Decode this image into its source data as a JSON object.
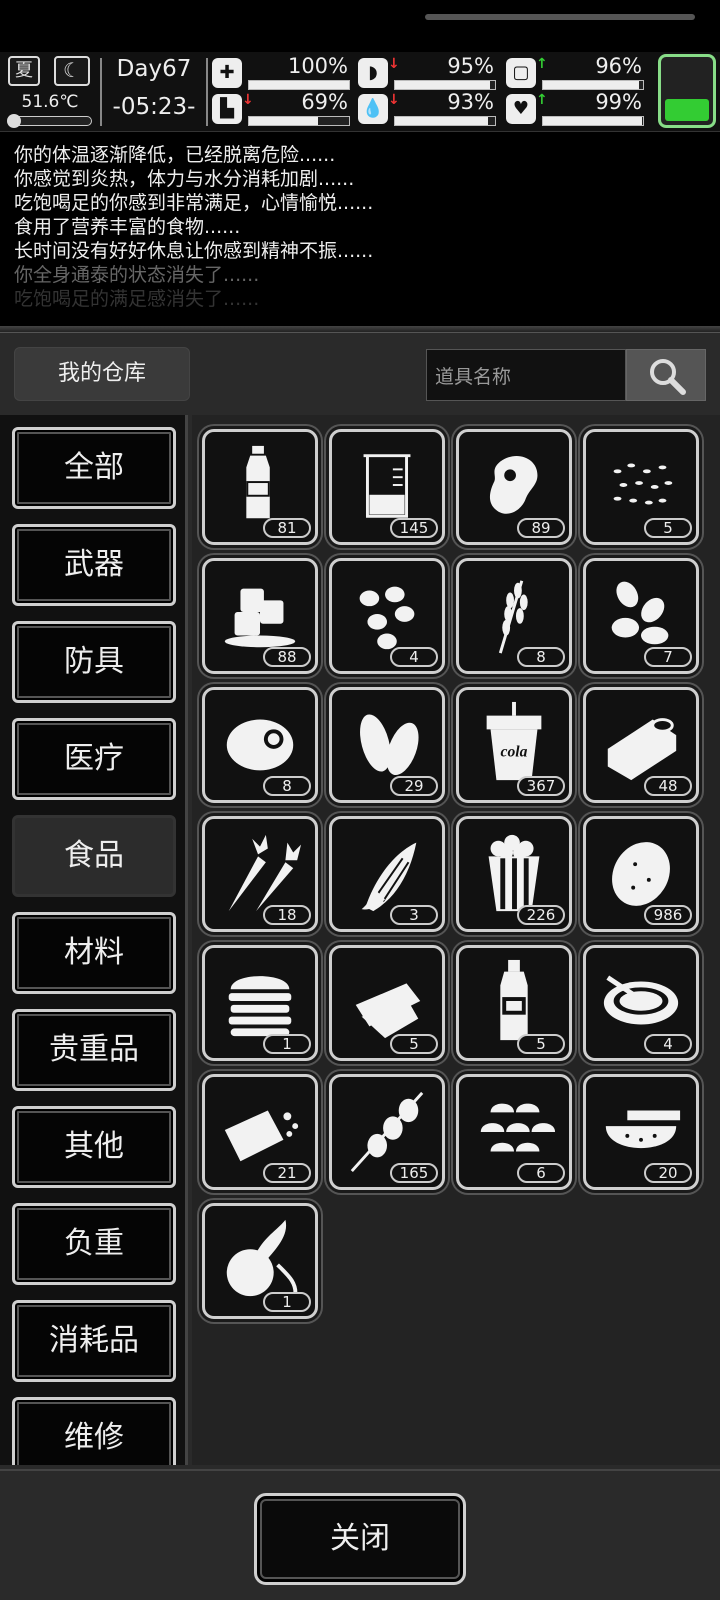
{
  "status": {
    "season": "夏",
    "temperature": "51.6℃",
    "day": "Day67",
    "time": "-05:23-",
    "battery_level": 0.35,
    "stats": [
      {
        "name": "health",
        "icon": "medkit-icon",
        "value": "100%",
        "fill": 1.0,
        "arrow": ""
      },
      {
        "name": "hunger",
        "icon": "stomach-icon",
        "value": "95%",
        "fill": 0.95,
        "arrow": "down"
      },
      {
        "name": "stamina",
        "icon": "lung-icon",
        "value": "96%",
        "fill": 0.96,
        "arrow": "up"
      },
      {
        "name": "foot",
        "icon": "boot-icon",
        "value": "69%",
        "fill": 0.69,
        "arrow": "down"
      },
      {
        "name": "thirst",
        "icon": "water-drop-icon",
        "value": "93%",
        "fill": 0.93,
        "arrow": "down"
      },
      {
        "name": "mood",
        "icon": "heart-icon",
        "value": "99%",
        "fill": 0.99,
        "arrow": "up"
      }
    ]
  },
  "log": [
    "你的体温逐渐降低，已经脱离危险......",
    "你感觉到炎热，体力与水分消耗加剧......",
    "吃饱喝足的你感到非常满足，心情愉悦......",
    "食用了营养丰富的食物......",
    "长时间没有好好休息让你感到精神不振......",
    "你全身通泰的状态消失了......",
    "吃饱喝足的满足感消失了......"
  ],
  "warehouse": {
    "title": "我的仓库",
    "search_placeholder": "道具名称"
  },
  "categories": [
    "全部",
    "武器",
    "防具",
    "医疗",
    "食品",
    "材料",
    "贵重品",
    "其他",
    "负重",
    "消耗品",
    "维修"
  ],
  "active_category": "食品",
  "items": [
    {
      "icon": "water-bottle-icon",
      "count": "81"
    },
    {
      "icon": "beaker-icon",
      "count": "145"
    },
    {
      "icon": "meat-icon",
      "count": "89"
    },
    {
      "icon": "seeds-icon",
      "count": "5"
    },
    {
      "icon": "ice-cubes-icon",
      "count": "88"
    },
    {
      "icon": "beans-icon",
      "count": "4"
    },
    {
      "icon": "wheat-icon",
      "count": "8"
    },
    {
      "icon": "almonds-icon",
      "count": "7"
    },
    {
      "icon": "egg-icon",
      "count": "8"
    },
    {
      "icon": "sunflower-seeds-icon",
      "count": "29"
    },
    {
      "icon": "cola-cup-icon",
      "count": "367",
      "label": "cola"
    },
    {
      "icon": "canned-food-icon",
      "count": "48"
    },
    {
      "icon": "carrot-icon",
      "count": "18"
    },
    {
      "icon": "corn-icon",
      "count": "3"
    },
    {
      "icon": "popcorn-icon",
      "count": "226"
    },
    {
      "icon": "potato-icon",
      "count": "986"
    },
    {
      "icon": "burger-icon",
      "count": "1"
    },
    {
      "icon": "bread-slice-icon",
      "count": "5"
    },
    {
      "icon": "sauce-bottle-icon",
      "count": "5"
    },
    {
      "icon": "soup-bowl-icon",
      "count": "4"
    },
    {
      "icon": "biscuit-icon",
      "count": "21"
    },
    {
      "icon": "skewer-icon",
      "count": "165"
    },
    {
      "icon": "dumplings-icon",
      "count": "6"
    },
    {
      "icon": "watermelon-icon",
      "count": "20"
    },
    {
      "icon": "onion-icon",
      "count": "1"
    }
  ],
  "close_label": "关闭"
}
